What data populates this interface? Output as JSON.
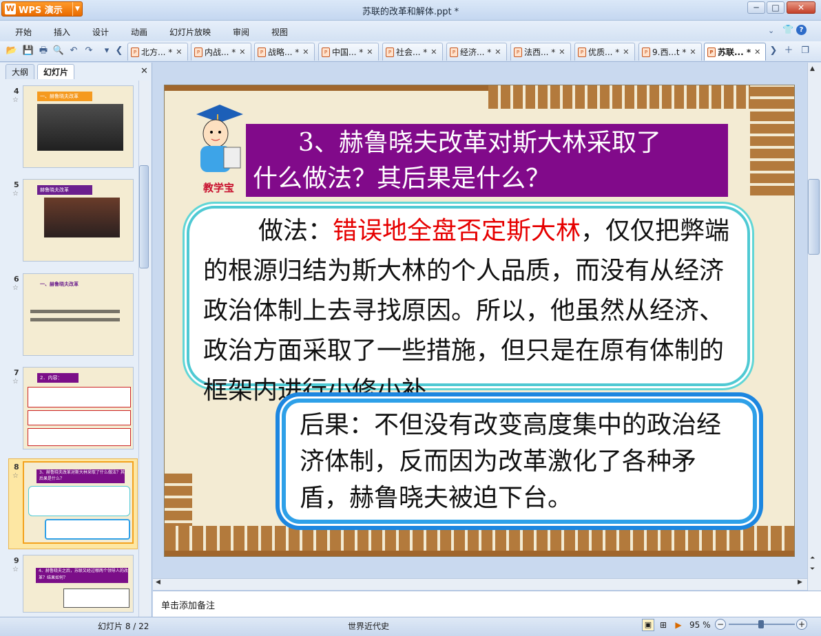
{
  "app": {
    "name": "WPS 演示",
    "title": "苏联的改革和解体.ppt *"
  },
  "menu": [
    "开始",
    "插入",
    "设计",
    "动画",
    "幻灯片放映",
    "审阅",
    "视图"
  ],
  "doc_tabs": [
    "北方... *",
    "内战... *",
    "战略... *",
    "中国... *",
    "社会... *",
    "经济... *",
    "法西... *",
    "优质... *",
    "9.西...t *",
    "苏联... *"
  ],
  "left_panel": {
    "tabs": [
      "大纲",
      "幻灯片"
    ],
    "thumbnails": [
      {
        "num": "4",
        "label": "一、赫鲁晓夫改革"
      },
      {
        "num": "5",
        "label": "赫鲁晓夫改革"
      },
      {
        "num": "6",
        "label": "一、赫鲁晓夫改革"
      },
      {
        "num": "7",
        "label": "2．内容："
      },
      {
        "num": "8",
        "label": "3、赫鲁晓夫改革对斯大林采取了什么做法？其后果是什么？"
      },
      {
        "num": "9",
        "label": "4、赫鲁晓夫之后，苏联又经过哪两个领导人的改革？结果如何？"
      }
    ],
    "selected": "8"
  },
  "slide": {
    "logo_text": "教学宝",
    "title_line1": "3、赫鲁晓夫改革对斯大林采取了",
    "title_line2": "什么做法？其后果是什么？",
    "method_label": "做法：",
    "method_red": "错误地全盘否定斯大林",
    "method_rest": "，仅仅把弊端的根源归结为斯大林的个人品质，而没有从经济政治体制上去寻找原因。所以，他虽然从经济、政治方面采取了一些措施，但只是在原有体制的框架内进行小修小补。",
    "result_text": "后果：不但没有改变高度集中的政治经济体制，反而因为改革激化了各种矛盾，赫鲁晓夫被迫下台。"
  },
  "notes_placeholder": "单击添加备注",
  "status": {
    "slide_counter": "幻灯片 8 / 22",
    "template": "世界近代史",
    "zoom": "95 %"
  },
  "colors": {
    "title_bg": "#810a8a",
    "accent_red": "#e60000",
    "box1_border": "#4fc9d3",
    "box2_border": "#2ea0e8"
  }
}
